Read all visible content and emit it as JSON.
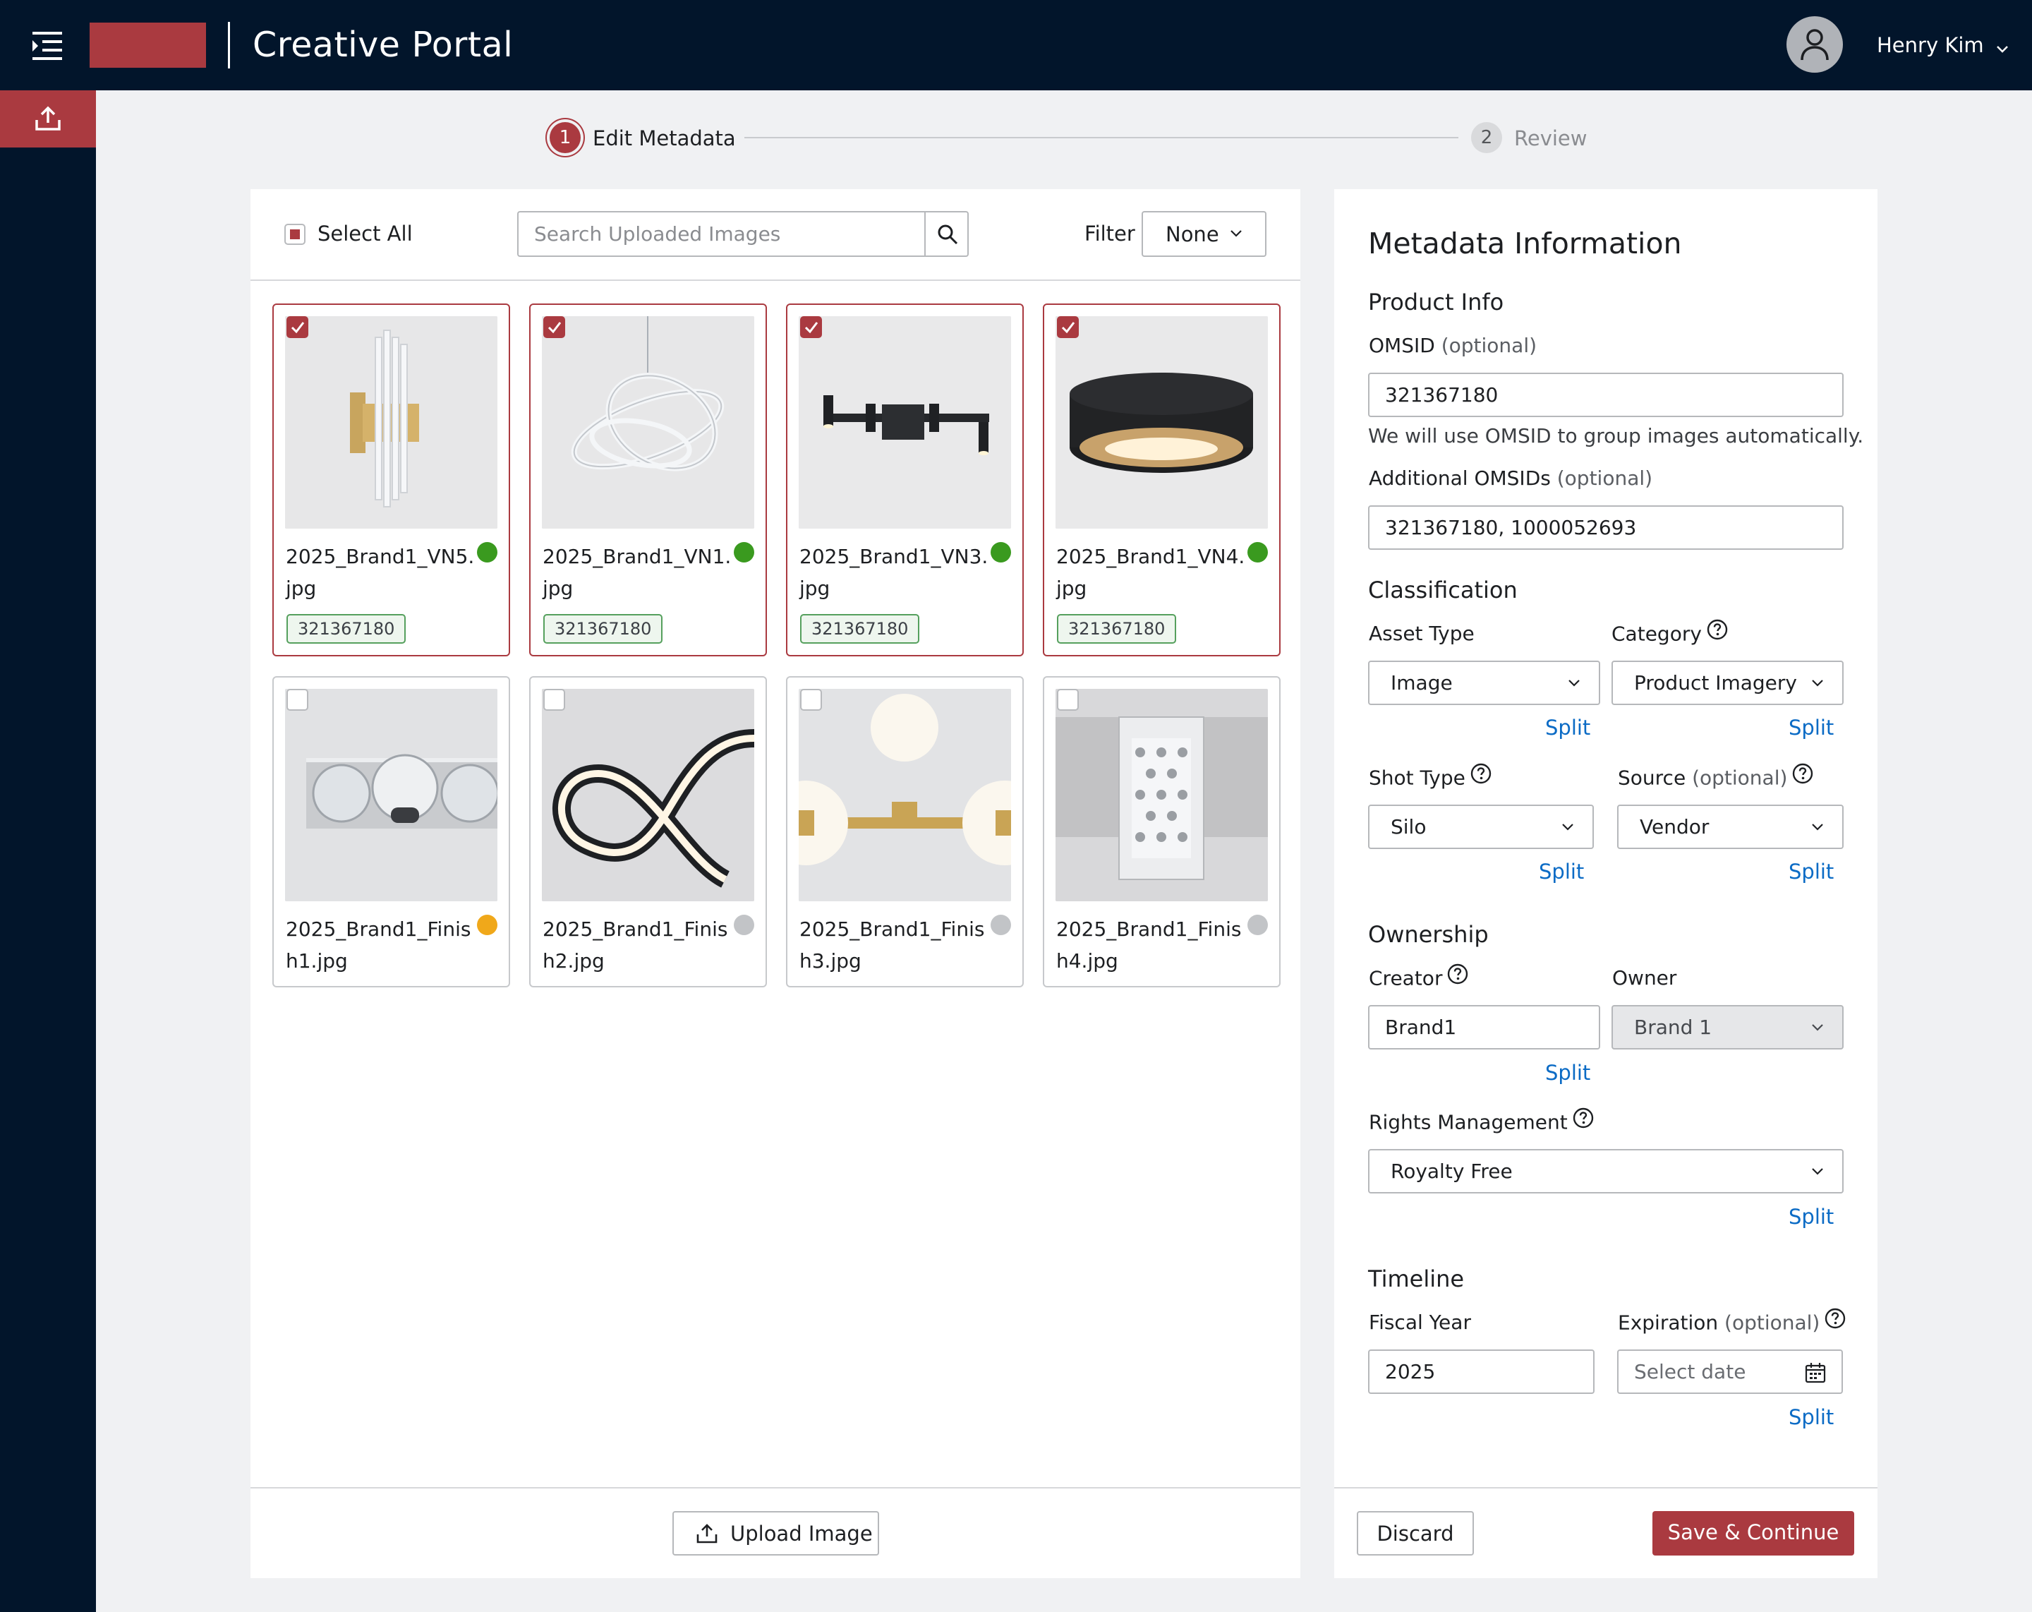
{
  "header": {
    "app_title": "Creative Portal",
    "user_name": "Henry Kim",
    "brand_color": "#aa3a40",
    "nav_color": "#02152b"
  },
  "stepper": {
    "steps": [
      {
        "number": "1",
        "label": "Edit Metadata",
        "active": true
      },
      {
        "number": "2",
        "label": "Review",
        "active": false
      }
    ]
  },
  "toolbar": {
    "select_all_label": "Select All",
    "search_placeholder": "Search Uploaded Images",
    "filter_label": "Filter",
    "filter_value": "None"
  },
  "images": [
    {
      "filename": "2025_Brand1_VN5.jpg",
      "line1": "2025_Brand1_VN5.",
      "line2": "jpg",
      "selected": true,
      "status": "green",
      "omsid": "321367180"
    },
    {
      "filename": "2025_Brand1_VN1.jpg",
      "line1": "2025_Brand1_VN1.",
      "line2": "jpg",
      "selected": true,
      "status": "green",
      "omsid": "321367180"
    },
    {
      "filename": "2025_Brand1_VN3.jpg",
      "line1": "2025_Brand1_VN3.",
      "line2": "jpg",
      "selected": true,
      "status": "green",
      "omsid": "321367180"
    },
    {
      "filename": "2025_Brand1_VN4.jpg",
      "line1": "2025_Brand1_VN4.",
      "line2": "jpg",
      "selected": true,
      "status": "green",
      "omsid": "321367180"
    },
    {
      "filename": "2025_Brand1_Finish1.jpg",
      "line1": "2025_Brand1_Finis",
      "line2": "h1.jpg",
      "selected": false,
      "status": "orange"
    },
    {
      "filename": "2025_Brand1_Finish2.jpg",
      "line1": "2025_Brand1_Finis",
      "line2": "h2.jpg",
      "selected": false,
      "status": "gray"
    },
    {
      "filename": "2025_Brand1_Finish3.jpg",
      "line1": "2025_Brand1_Finis",
      "line2": "h3.jpg",
      "selected": false,
      "status": "gray"
    },
    {
      "filename": "2025_Brand1_Finish4.jpg",
      "line1": "2025_Brand1_Finis",
      "line2": "h4.jpg",
      "selected": false,
      "status": "gray"
    }
  ],
  "status_colors": {
    "green": "#3a9a1f",
    "orange": "#f0a81a",
    "gray": "#c2c4c7"
  },
  "upload_button_label": "Upload Image",
  "metadata": {
    "title": "Metadata Information",
    "product_info": {
      "heading": "Product Info",
      "omsid_label": "OMSID",
      "omsid_optional": "(optional)",
      "omsid_value": "321367180",
      "omsid_help": "We will use OMSID to group images automatically.",
      "additional_label": "Additional OMSIDs",
      "additional_optional": "(optional)",
      "additional_value": "321367180, 1000052693"
    },
    "classification": {
      "heading": "Classification",
      "asset_type_label": "Asset Type",
      "asset_type_value": "Image",
      "category_label": "Category",
      "category_value": "Product Imagery",
      "shot_type_label": "Shot Type",
      "shot_type_value": "Silo",
      "source_label": "Source",
      "source_optional": "(optional)",
      "source_value": "Vendor"
    },
    "ownership": {
      "heading": "Ownership",
      "creator_label": "Creator",
      "creator_value": "Brand1",
      "owner_label": "Owner",
      "owner_value": "Brand 1",
      "rights_label": "Rights Management",
      "rights_value": "Royalty Free"
    },
    "timeline": {
      "heading": "Timeline",
      "fiscal_year_label": "Fiscal Year",
      "fiscal_year_value": "2025",
      "expiration_label": "Expiration",
      "expiration_optional": "(optional)",
      "expiration_placeholder": "Select date"
    },
    "split_label": "Split"
  },
  "footer": {
    "discard_label": "Discard",
    "save_label": "Save & Continue"
  }
}
